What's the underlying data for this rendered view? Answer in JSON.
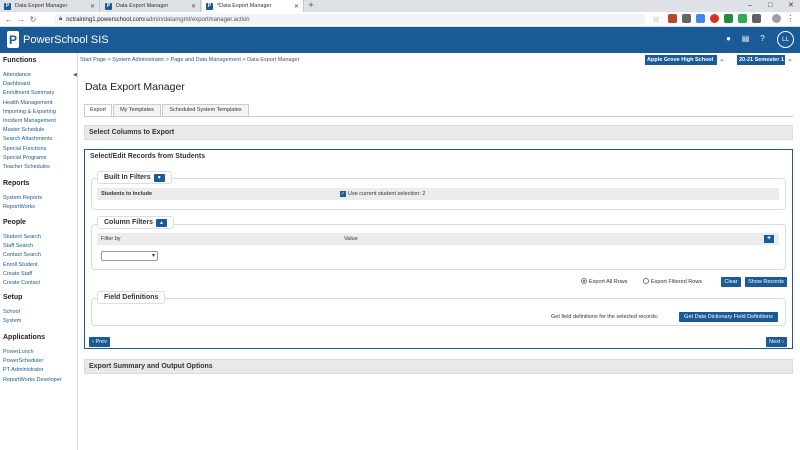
{
  "browser": {
    "tabs": [
      {
        "label": "Data Export Manager"
      },
      {
        "label": "Data Export Manager"
      },
      {
        "label": "*Data Export Manager"
      }
    ],
    "new_tab": "+",
    "url_host": "nctraining1.powerschool.com",
    "url_path": "/admin/datamgmt/exportmanager.action",
    "minimize": "–",
    "maximize": "□",
    "close": "✕"
  },
  "header": {
    "logo_letter": "P",
    "logo_text": "PowerSchool SIS",
    "avatar_initials": "LL"
  },
  "sidebar": {
    "sections": [
      {
        "title": "Functions",
        "items": [
          "Attendance",
          "Dashboard",
          "Enrollment Summary",
          "Health Management",
          "Importing & Exporting",
          "Incident Management",
          "Master Schedule",
          "Search Attachments",
          "Special Functions",
          "Special Programs",
          "Teacher Schedules"
        ]
      },
      {
        "title": "Reports",
        "items": [
          "System Reports",
          "ReportWorks"
        ]
      },
      {
        "title": "People",
        "items": [
          "Student Search",
          "Staff Search",
          "Contact Search",
          "Enroll Student",
          "Create Staff",
          "Create Contact"
        ]
      },
      {
        "title": "Setup",
        "items": [
          "School",
          "System"
        ]
      },
      {
        "title": "Applications",
        "items": [
          "PowerLunch",
          "PowerScheduler",
          "PT Administrator",
          "ReportWorks Developer"
        ]
      }
    ]
  },
  "breadcrumb": {
    "items": [
      "Start Page",
      "System Administrator",
      "Page and Data Management"
    ],
    "current": "Data Export Manager",
    "separator": ">"
  },
  "selectors": {
    "school": "Apple Grove High School",
    "term": "20-21 Semester 1"
  },
  "page": {
    "title": "Data Export Manager",
    "tabs": [
      "Export",
      "My Templates",
      "Scheduled System Templates"
    ],
    "select_columns_header": "Select Columns to Export",
    "records_header": "Select/Edit Records from Students",
    "built_in_filters": {
      "legend": "Built In Filters",
      "students_label": "Students to include",
      "use_current_label": "Use current student selection:",
      "use_current_count": "2"
    },
    "column_filters": {
      "legend": "Column Filters",
      "filter_by": "Filter by",
      "value": "Value"
    },
    "export_options": {
      "all_rows": "Export All Rows",
      "filtered_rows": "Export Filtered Rows",
      "clear": "Clear",
      "show_records": "Show Records"
    },
    "field_definitions": {
      "legend": "Field Definitions",
      "text": "Get field definitions for the selected records:",
      "button": "Get Data Dictionary Field Definitions"
    },
    "prev": "‹ Prev",
    "next": "Next ›",
    "summary_header": "Export Summary and Output Options"
  }
}
